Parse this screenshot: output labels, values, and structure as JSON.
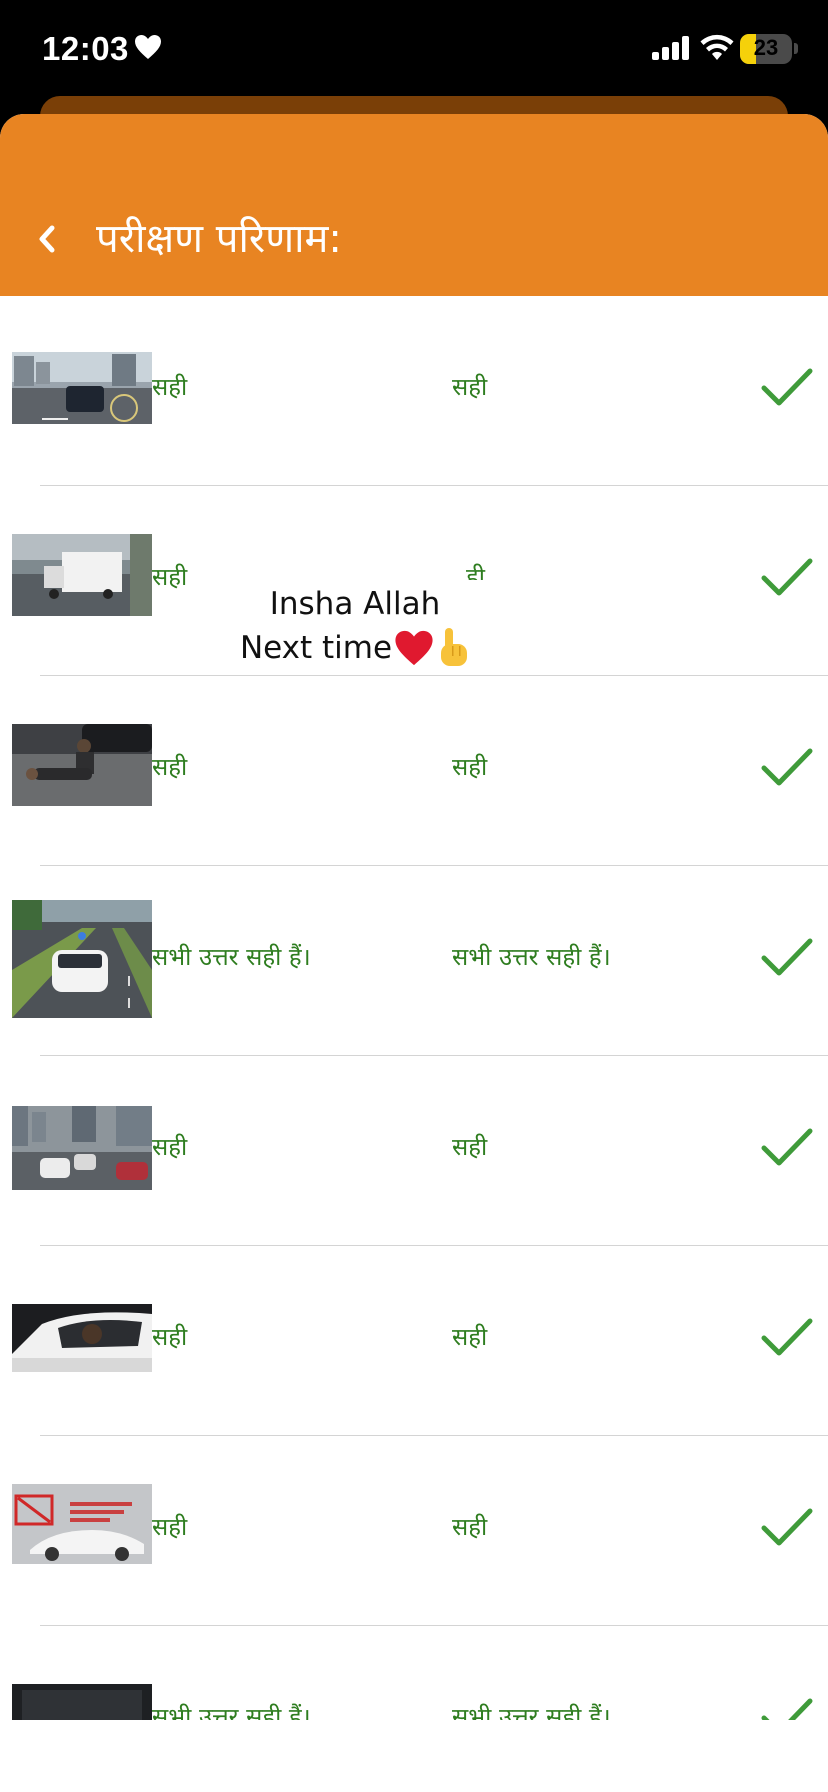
{
  "status_bar": {
    "time": "12:03",
    "battery": "23",
    "icons": [
      "heart-icon",
      "signal-icon",
      "wifi-icon",
      "battery-icon"
    ]
  },
  "header": {
    "title": "परीक्षण परिणाम:",
    "back_icon": "chevron-left-icon"
  },
  "results": [
    {
      "your_answer": "सही",
      "correct_answer": "सही",
      "status": "correct"
    },
    {
      "your_answer": "सही",
      "correct_answer": "ही",
      "status": "correct"
    },
    {
      "your_answer": "सही",
      "correct_answer": "सही",
      "status": "correct"
    },
    {
      "your_answer": "सभी उत्तर सही हैं।",
      "correct_answer": "सभी उत्तर सही हैं।",
      "status": "correct"
    },
    {
      "your_answer": "सही",
      "correct_answer": "सही",
      "status": "correct"
    },
    {
      "your_answer": "सही",
      "correct_answer": "सही",
      "status": "correct"
    },
    {
      "your_answer": "सही",
      "correct_answer": "सही",
      "status": "correct"
    },
    {
      "your_answer": "सभी उत्तर सही हैं।",
      "correct_answer": "सभी उत्तर सही हैं।",
      "status": "correct"
    }
  ],
  "overlay": {
    "line1": "Insha Allah",
    "line2": "Next time"
  },
  "colors": {
    "header": "#e88422",
    "answer_text": "#2e7d1f",
    "check": "#3f9b3a"
  }
}
